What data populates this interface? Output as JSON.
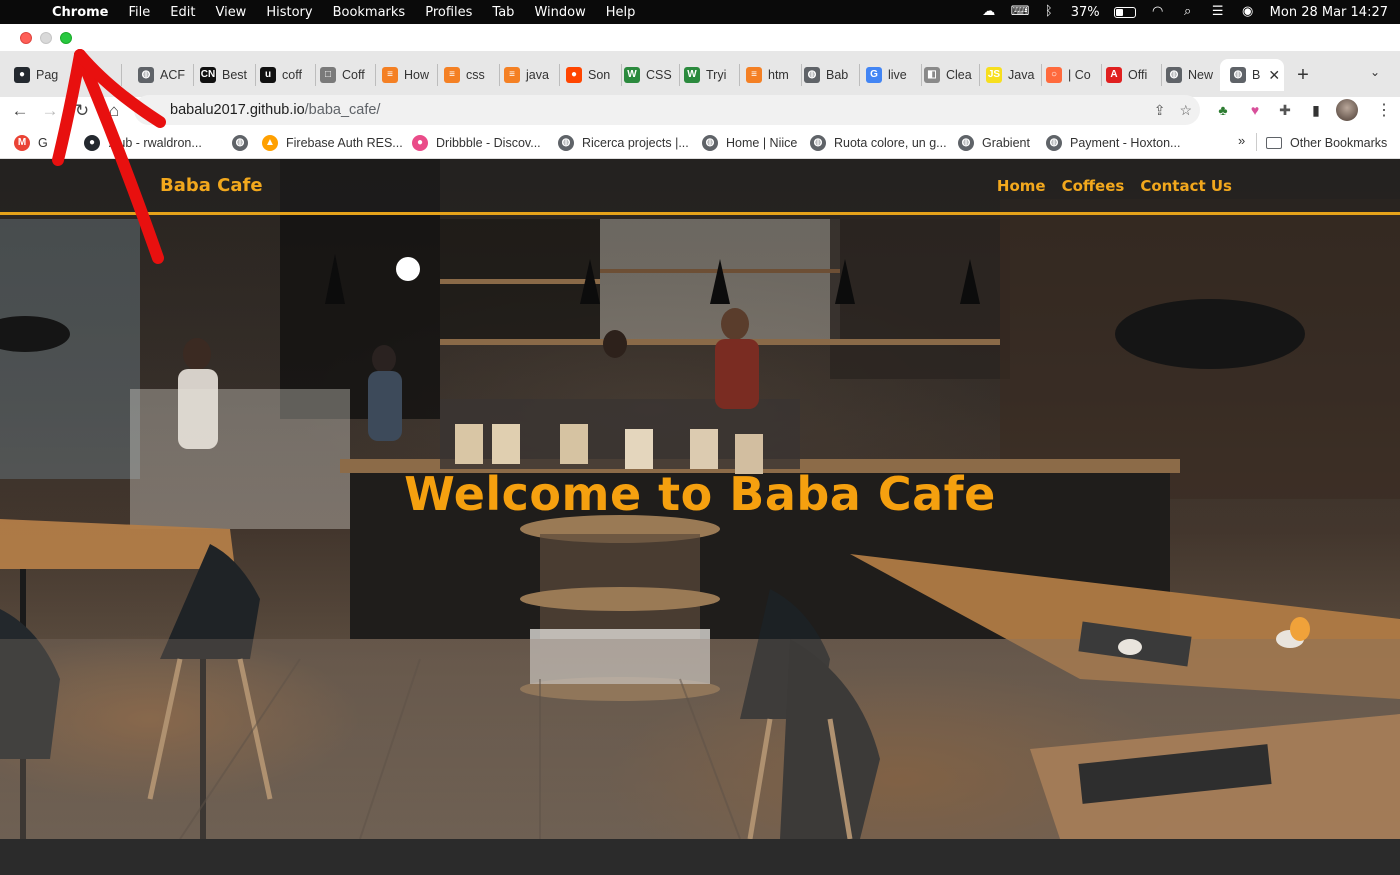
{
  "menubar": {
    "app": "Chrome",
    "items": [
      "File",
      "Edit",
      "View",
      "History",
      "Bookmarks",
      "Profiles",
      "Tab",
      "Window",
      "Help"
    ],
    "battery": "37%",
    "datetime": "Mon 28 Mar  14:27"
  },
  "tabs": [
    {
      "label": "Pag",
      "color": "#24292f",
      "glyph": "●"
    },
    {
      "label": "ACF",
      "color": "#5f6368",
      "glyph": "◍"
    },
    {
      "label": "Best",
      "color": "#111111",
      "glyph": "CN"
    },
    {
      "label": "coff",
      "color": "#111111",
      "glyph": "u"
    },
    {
      "label": "Coff",
      "color": "#7a7a7a",
      "glyph": "□"
    },
    {
      "label": "How",
      "color": "#f48024",
      "glyph": "≡"
    },
    {
      "label": "css",
      "color": "#f48024",
      "glyph": "≡"
    },
    {
      "label": "java",
      "color": "#f48024",
      "glyph": "≡"
    },
    {
      "label": "Son",
      "color": "#ff4500",
      "glyph": "●"
    },
    {
      "label": "CSS",
      "color": "#2b8a3e",
      "glyph": "W"
    },
    {
      "label": "Tryi",
      "color": "#2b8a3e",
      "glyph": "W"
    },
    {
      "label": "htm",
      "color": "#f48024",
      "glyph": "≡"
    },
    {
      "label": "Bab",
      "color": "#5f6368",
      "glyph": "◍"
    },
    {
      "label": "live",
      "color": "#4285f4",
      "glyph": "G"
    },
    {
      "label": "Clea",
      "color": "#8a8a8a",
      "glyph": "◧"
    },
    {
      "label": "Java",
      "color": "#f7df1e",
      "glyph": "JS"
    },
    {
      "label": "| Co",
      "color": "#ff6a3d",
      "glyph": "○"
    },
    {
      "label": "Offi",
      "color": "#e02020",
      "glyph": "A"
    },
    {
      "label": "New",
      "color": "#5f6368",
      "glyph": "◍"
    },
    {
      "label": "B",
      "color": "#5f6368",
      "glyph": "◍"
    }
  ],
  "url": {
    "host": "babalu2017.github.io",
    "path": "/baba_cafe/"
  },
  "bookmarks": [
    {
      "label": "G",
      "color": "#ea4335",
      "glyph": "M"
    },
    {
      "label": "...ub - rwaldron...",
      "color": "#24292f",
      "glyph": "●"
    },
    {
      "label": "",
      "color": "#5f6368",
      "glyph": "◍"
    },
    {
      "label": "Firebase Auth RES...",
      "color": "#ffa000",
      "glyph": "▲"
    },
    {
      "label": "Dribbble - Discov...",
      "color": "#ea4c89",
      "glyph": "●"
    },
    {
      "label": "Ricerca projects |...",
      "color": "#5f6368",
      "glyph": "◍"
    },
    {
      "label": "Home | Niice",
      "color": "#5f6368",
      "glyph": "◍"
    },
    {
      "label": "Ruota colore, un g...",
      "color": "#5f6368",
      "glyph": "◍"
    },
    {
      "label": "Grabient",
      "color": "#5f6368",
      "glyph": "◍"
    },
    {
      "label": "Payment - Hoxton...",
      "color": "#5f6368",
      "glyph": "◍"
    }
  ],
  "bookmarks_more": "»",
  "other_bookmarks": "Other Bookmarks",
  "site": {
    "brand": "Baba Cafe",
    "nav": [
      "Home",
      "Coffees",
      "Contact Us"
    ],
    "hero": "Welcome to Baba Cafe",
    "accent": "#f2a81d"
  }
}
